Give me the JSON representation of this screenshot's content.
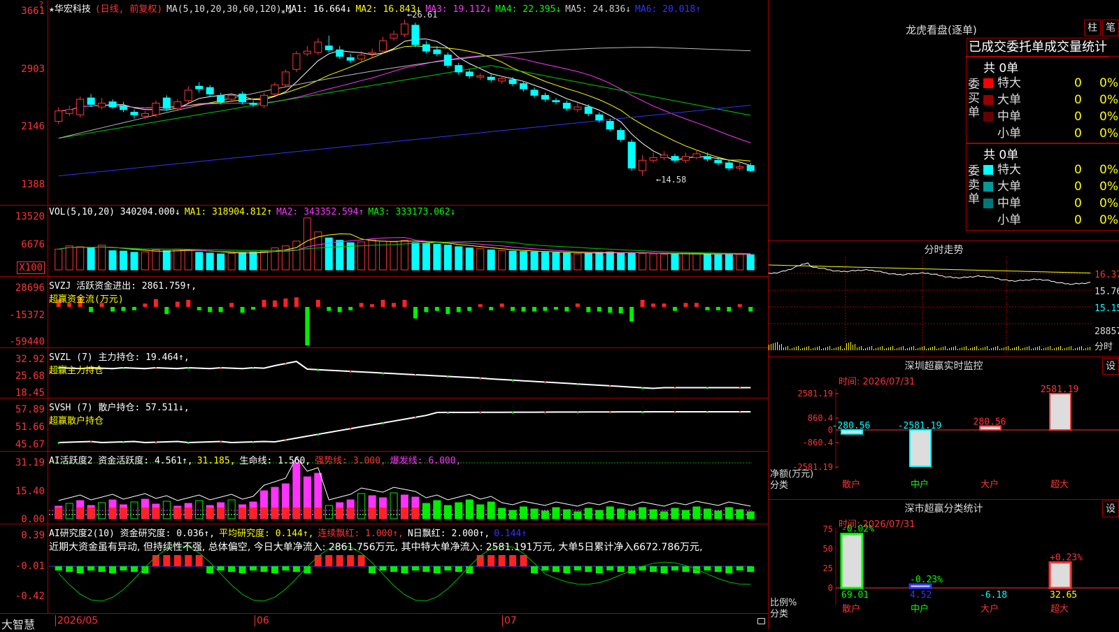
{
  "stock": {
    "star": "★",
    "name": "华宏科技",
    "period": "(日线, 前复权)",
    "ma_label": "MA(5,10,20,30,60,120)",
    "ma_values": [
      {
        "label": "MA1: 16.664↓",
        "color": "#ffffff"
      },
      {
        "label": "MA2: 16.843↓",
        "color": "#ffff00"
      },
      {
        "label": "MA3: 19.112↓",
        "color": "#ff33ff"
      },
      {
        "label": "MA4: 22.395↓",
        "color": "#00ff00"
      },
      {
        "label": "MA5: 24.836↓",
        "color": "#cccccc"
      },
      {
        "label": "MA6: 20.018↑",
        "color": "#3333ff"
      }
    ],
    "price_axis": [
      "3661",
      "2903",
      "2146",
      "1388"
    ],
    "high_label": "←26.61",
    "low_label": "←14.58",
    "left_corner": "?",
    "stars": "* *"
  },
  "vol": {
    "header": [
      "VOL(5,10,20)  340204.000↓",
      "MA1: 318904.812↑",
      "MA2: 343352.594↑",
      "MA3: 333173.062↓"
    ],
    "header_colors": [
      "#ffffff",
      "#ffff00",
      "#ff33ff",
      "#00ff00"
    ],
    "axis": [
      "13520",
      "6676"
    ],
    "unit": "X100"
  },
  "svzj": {
    "line1": "SVZJ  活跃资金进出: 2861.759↑,",
    "line2": "超赢资金流(万元)",
    "axis": [
      "28696",
      "-15372",
      "-59440"
    ]
  },
  "svzl": {
    "line1": "SVZL (7) 主力持仓: 19.464↑,",
    "line2": "超赢主力持仓",
    "axis": [
      "32.92",
      "25.68",
      "18.45"
    ]
  },
  "svsh": {
    "line1": "SVSH (7) 散户持仓: 57.511↓,",
    "line2": "超赢散户持仓",
    "axis": [
      "57.89",
      "51.66",
      "45.67"
    ]
  },
  "ai_active": {
    "parts": [
      {
        "t": "AI活跃度2 资金活跃度: 4.561↑,",
        "c": "#ffffff"
      },
      {
        "t": "31.185,",
        "c": "#ffff00"
      },
      {
        "t": "生命线: 1.560,",
        "c": "#ffffff"
      },
      {
        "t": "强势线: 3.000,",
        "c": "#ff3333"
      },
      {
        "t": "爆发线: 6.000,",
        "c": "#ff33ff"
      }
    ],
    "axis": [
      "31.19",
      "15.40",
      "0.00"
    ]
  },
  "ai_research": {
    "parts": [
      {
        "t": "AI研究度2(10) 资金研究度: 0.036↑,",
        "c": "#ffffff"
      },
      {
        "t": "平均研究度: 0.144↑,",
        "c": "#ffff00"
      },
      {
        "t": "连续飘红: 1.000↑,",
        "c": "#ff3333"
      },
      {
        "t": "N日飘红: 2.000↑,",
        "c": "#ffffff"
      },
      {
        "t": "0.144↑",
        "c": "#3333ff"
      }
    ],
    "comment": "近期大资金虽有异动, 但持续性不强, 总体偏空, 今日大单净流入: 2861.756万元, 其中特大单净流入: 2581.191万元, 大单5日累计净入6672.786万元, ",
    "axis": [
      "0.39",
      "-0.01",
      "-0.42"
    ]
  },
  "bottom": {
    "brand": "大智慧",
    "dates": [
      "2026/05",
      "06",
      "07"
    ]
  },
  "lhb": {
    "title": "龙虎看盘(逐单)",
    "btn1": "柱",
    "btn2": "笔",
    "tabs": "已成交委托单成交量统计",
    "buy_label": "委买单",
    "sell_label": "委卖单",
    "buy_total": "共 0单",
    "sell_total": "共 0单",
    "buy_rows": [
      {
        "name": "特大",
        "count": "0",
        "pct": "0%",
        "color": "#ff0000"
      },
      {
        "name": "大单",
        "count": "0",
        "pct": "0%",
        "color": "#990000"
      },
      {
        "name": "中单",
        "count": "0",
        "pct": "0%",
        "color": "#660000"
      },
      {
        "name": "小单",
        "count": "0",
        "pct": "0%",
        "color": ""
      }
    ],
    "sell_rows": [
      {
        "name": "特大",
        "count": "0",
        "pct": "0%",
        "color": "#00ffff"
      },
      {
        "name": "大单",
        "count": "0",
        "pct": "0%",
        "color": "#009999"
      },
      {
        "name": "中单",
        "count": "0",
        "pct": "0%",
        "color": "#007777"
      },
      {
        "name": "小单",
        "count": "0",
        "pct": "0%",
        "color": ""
      }
    ]
  },
  "intraday": {
    "title": "分时走势",
    "right_axis": [
      "16.37",
      "15.76",
      "15.15",
      "28857"
    ],
    "time_label": "分时"
  },
  "sz_monitor": {
    "title": "深圳超赢实时监控",
    "btn": "设",
    "time": "时间: 2026/07/31",
    "axis": [
      "2581.19",
      "860.4",
      "0",
      "-860.4",
      "-2581.19"
    ],
    "unit1": "净额(万元)",
    "unit2": "分类",
    "cats": [
      "散户",
      "中户",
      "大户",
      "超大"
    ],
    "values": [
      -280.56,
      -2581.19,
      280.56,
      2581.19
    ],
    "value_labels": [
      "-280.56",
      "-2581.19",
      "280.56",
      "2581.19"
    ]
  },
  "sz_class": {
    "title": "深市超赢分类统计",
    "btn": "设",
    "time": "时间: 2026/07/31",
    "axis": [
      "75",
      "50",
      "25",
      "0"
    ],
    "unit1": "比例%",
    "unit2": "分类",
    "cats": [
      "散户",
      "中户",
      "大户",
      "超大"
    ],
    "pct_labels": [
      "-0.02%",
      "-0.23%",
      "",
      "+0.23%"
    ],
    "bottom_vals": [
      "69.01",
      "4.52",
      "-6.18",
      "32.65"
    ],
    "bottom_colors": [
      "#00ff00",
      "#3333ff",
      "#00ffff",
      "#ffff00"
    ]
  },
  "chart_data": {
    "type": "candlestick",
    "title": "华宏科技 (日线, 前复权)",
    "price_high": 26.61,
    "price_low": 14.58,
    "yaxis_ticks": [
      "3661",
      "2903",
      "2146",
      "1388"
    ],
    "x_ticks": [
      "2026/05",
      "06",
      "07"
    ],
    "candles": [
      {
        "o": 18.8,
        "c": 19.6,
        "h": 19.9,
        "l": 18.6
      },
      {
        "o": 19.4,
        "c": 19.7,
        "h": 20.0,
        "l": 19.2
      },
      {
        "o": 19.3,
        "c": 20.5,
        "h": 20.7,
        "l": 19.1
      },
      {
        "o": 20.6,
        "c": 20.1,
        "h": 20.9,
        "l": 19.9
      },
      {
        "o": 19.9,
        "c": 20.2,
        "h": 20.6,
        "l": 19.7
      },
      {
        "o": 20.3,
        "c": 19.9,
        "h": 20.5,
        "l": 19.8
      },
      {
        "o": 20.0,
        "c": 19.7,
        "h": 20.3,
        "l": 19.5
      },
      {
        "o": 19.5,
        "c": 19.3,
        "h": 19.7,
        "l": 19.0
      },
      {
        "o": 19.2,
        "c": 19.4,
        "h": 19.6,
        "l": 19.0
      },
      {
        "o": 19.3,
        "c": 20.2,
        "h": 20.4,
        "l": 19.1
      },
      {
        "o": 20.6,
        "c": 19.8,
        "h": 20.8,
        "l": 19.6
      },
      {
        "o": 19.8,
        "c": 20.3,
        "h": 20.5,
        "l": 19.6
      },
      {
        "o": 20.4,
        "c": 21.2,
        "h": 21.5,
        "l": 20.2
      },
      {
        "o": 21.5,
        "c": 21.3,
        "h": 21.8,
        "l": 21.0
      },
      {
        "o": 21.4,
        "c": 20.9,
        "h": 21.6,
        "l": 20.7
      },
      {
        "o": 20.8,
        "c": 20.3,
        "h": 21.0,
        "l": 20.1
      },
      {
        "o": 20.5,
        "c": 20.8,
        "h": 21.0,
        "l": 20.3
      },
      {
        "o": 20.9,
        "c": 20.3,
        "h": 21.1,
        "l": 20.1
      },
      {
        "o": 20.2,
        "c": 20.1,
        "h": 20.4,
        "l": 19.9
      },
      {
        "o": 20.0,
        "c": 20.8,
        "h": 21.0,
        "l": 19.8
      },
      {
        "o": 20.9,
        "c": 21.6,
        "h": 21.8,
        "l": 20.8
      },
      {
        "o": 21.6,
        "c": 22.6,
        "h": 22.8,
        "l": 21.5
      },
      {
        "o": 22.8,
        "c": 24.0,
        "h": 24.2,
        "l": 22.6
      },
      {
        "o": 24.0,
        "c": 24.2,
        "h": 24.6,
        "l": 23.8
      },
      {
        "o": 24.1,
        "c": 24.9,
        "h": 25.2,
        "l": 23.9
      },
      {
        "o": 24.6,
        "c": 24.3,
        "h": 25.4,
        "l": 24.1
      },
      {
        "o": 24.3,
        "c": 23.8,
        "h": 24.6,
        "l": 23.6
      },
      {
        "o": 23.7,
        "c": 23.5,
        "h": 24.0,
        "l": 23.3
      },
      {
        "o": 23.6,
        "c": 23.9,
        "h": 24.2,
        "l": 23.3
      },
      {
        "o": 24.0,
        "c": 24.1,
        "h": 24.4,
        "l": 23.7
      },
      {
        "o": 24.2,
        "c": 25.0,
        "h": 25.3,
        "l": 24.0
      },
      {
        "o": 25.2,
        "c": 25.5,
        "h": 25.8,
        "l": 25.0
      },
      {
        "o": 25.5,
        "c": 26.3,
        "h": 26.61,
        "l": 25.3
      },
      {
        "o": 26.2,
        "c": 24.7,
        "h": 26.4,
        "l": 24.5
      },
      {
        "o": 24.7,
        "c": 24.2,
        "h": 25.0,
        "l": 24.0
      },
      {
        "o": 24.3,
        "c": 24.0,
        "h": 24.6,
        "l": 23.8
      },
      {
        "o": 23.9,
        "c": 23.1,
        "h": 24.1,
        "l": 22.9
      },
      {
        "o": 23.1,
        "c": 22.6,
        "h": 23.3,
        "l": 22.4
      },
      {
        "o": 22.6,
        "c": 22.3,
        "h": 22.8,
        "l": 22.1
      },
      {
        "o": 22.2,
        "c": 22.3,
        "h": 22.5,
        "l": 22.0
      },
      {
        "o": 22.2,
        "c": 22.0,
        "h": 22.4,
        "l": 21.8
      },
      {
        "o": 21.9,
        "c": 22.1,
        "h": 22.3,
        "l": 21.7
      },
      {
        "o": 22.0,
        "c": 21.7,
        "h": 22.2,
        "l": 21.5
      },
      {
        "o": 21.7,
        "c": 21.3,
        "h": 21.9,
        "l": 21.1
      },
      {
        "o": 21.2,
        "c": 20.8,
        "h": 21.4,
        "l": 20.6
      },
      {
        "o": 20.8,
        "c": 20.5,
        "h": 21.0,
        "l": 20.3
      },
      {
        "o": 20.4,
        "c": 20.3,
        "h": 20.6,
        "l": 20.1
      },
      {
        "o": 20.2,
        "c": 19.8,
        "h": 20.4,
        "l": 19.6
      },
      {
        "o": 19.7,
        "c": 19.9,
        "h": 20.2,
        "l": 19.5
      },
      {
        "o": 19.9,
        "c": 19.4,
        "h": 20.1,
        "l": 19.2
      },
      {
        "o": 19.3,
        "c": 18.9,
        "h": 19.5,
        "l": 18.7
      },
      {
        "o": 18.8,
        "c": 18.2,
        "h": 19.0,
        "l": 18.0
      },
      {
        "o": 18.1,
        "c": 17.4,
        "h": 18.3,
        "l": 17.2
      },
      {
        "o": 17.2,
        "c": 15.2,
        "h": 17.4,
        "l": 15.0
      },
      {
        "o": 15.0,
        "c": 15.8,
        "h": 16.2,
        "l": 14.58
      },
      {
        "o": 15.8,
        "c": 16.0,
        "h": 16.4,
        "l": 15.6
      },
      {
        "o": 16.0,
        "c": 16.2,
        "h": 16.5,
        "l": 15.8
      },
      {
        "o": 16.1,
        "c": 15.8,
        "h": 16.3,
        "l": 15.6
      },
      {
        "o": 15.8,
        "c": 16.1,
        "h": 16.4,
        "l": 15.6
      },
      {
        "o": 16.0,
        "c": 16.3,
        "h": 16.6,
        "l": 15.9
      },
      {
        "o": 16.1,
        "c": 15.9,
        "h": 16.4,
        "l": 15.7
      },
      {
        "o": 15.8,
        "c": 15.6,
        "h": 16.0,
        "l": 15.4
      },
      {
        "o": 15.6,
        "c": 15.2,
        "h": 15.8,
        "l": 15.0
      },
      {
        "o": 15.2,
        "c": 15.3,
        "h": 15.6,
        "l": 15.0
      },
      {
        "o": 15.4,
        "c": 15.0,
        "h": 15.6,
        "l": 14.9
      }
    ],
    "volume": [
      52,
      60,
      58,
      55,
      62,
      48,
      47,
      44,
      45,
      50,
      48,
      52,
      49,
      44,
      42,
      40,
      41,
      43,
      45,
      47,
      55,
      60,
      72,
      130,
      95,
      80,
      74,
      68,
      70,
      75,
      72,
      70,
      74,
      68,
      66,
      64,
      62,
      58,
      55,
      53,
      50,
      48,
      47,
      46,
      45,
      44,
      43,
      42,
      40,
      42,
      44,
      45,
      43,
      42,
      41,
      40,
      39,
      40,
      41,
      40,
      39,
      38,
      40,
      39,
      38
    ]
  }
}
